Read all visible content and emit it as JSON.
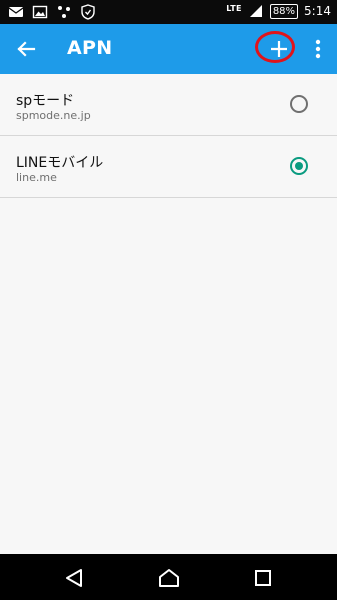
{
  "status_bar": {
    "network": "LTE",
    "battery": "88%",
    "time": "5:14"
  },
  "app_bar": {
    "title": "APN"
  },
  "apn_list": [
    {
      "name": "spモード",
      "apn": "spmode.ne.jp",
      "selected": false
    },
    {
      "name": "LINEモバイル",
      "apn": "line.me",
      "selected": true
    }
  ],
  "colors": {
    "app_bar": "#1e9be9",
    "radio_selected": "#0a9b80",
    "highlight_ring": "#e0141b"
  },
  "icons": {
    "back": "arrow-left-icon",
    "add": "plus-icon",
    "more": "more-vertical-icon",
    "nav_back": "triangle-back-icon",
    "nav_home": "circle-home-icon",
    "nav_recent": "square-recent-icon"
  }
}
